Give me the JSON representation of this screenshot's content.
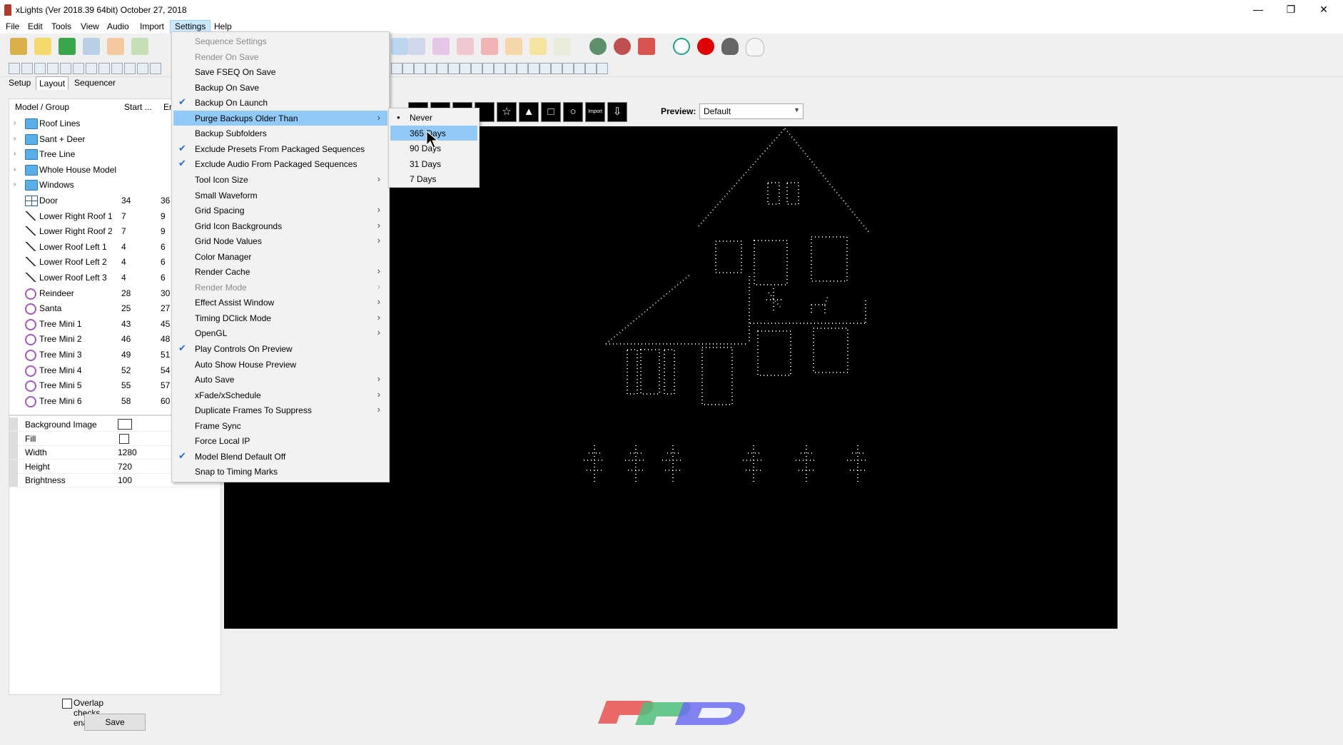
{
  "window": {
    "title": "xLights  (Ver 2018.39 64bit) October 27, 2018",
    "minimize": "—",
    "restore": "❐",
    "close": "✕"
  },
  "menubar": [
    "File",
    "Edit",
    "Tools",
    "View",
    "Audio",
    "Import",
    "Settings",
    "Help"
  ],
  "tabs": [
    "Setup",
    "Layout",
    "Sequencer"
  ],
  "model_list": {
    "headers": {
      "name": "Model / Group",
      "start": "Start ...",
      "end": "Er"
    },
    "rows": [
      {
        "name": "Roof Lines",
        "start": "",
        "end": "",
        "icon": "folder-icon",
        "expand": "›"
      },
      {
        "name": "Sant + Deer",
        "start": "",
        "end": "",
        "icon": "folder-icon",
        "expand": "›"
      },
      {
        "name": "Tree Line",
        "start": "",
        "end": "",
        "icon": "folder-icon",
        "expand": "›"
      },
      {
        "name": "Whole House Model",
        "start": "",
        "end": "",
        "icon": "folder-icon",
        "expand": "›"
      },
      {
        "name": "Windows",
        "start": "",
        "end": "",
        "icon": "folder-icon",
        "expand": "›"
      },
      {
        "name": "Door",
        "start": "34",
        "end": "36",
        "icon": "grid-icon",
        "expand": ""
      },
      {
        "name": "Lower Right Roof 1",
        "start": "7",
        "end": "9",
        "icon": "line-icon",
        "expand": ""
      },
      {
        "name": "Lower Right Roof 2",
        "start": "7",
        "end": "9",
        "icon": "line-icon",
        "expand": ""
      },
      {
        "name": "Lower Roof Left 1",
        "start": "4",
        "end": "6",
        "icon": "line-icon",
        "expand": ""
      },
      {
        "name": "Lower Roof Left 2",
        "start": "4",
        "end": "6",
        "icon": "line-icon",
        "expand": ""
      },
      {
        "name": "Lower Roof Left 3",
        "start": "4",
        "end": "6",
        "icon": "line-icon",
        "expand": ""
      },
      {
        "name": "Reindeer",
        "start": "28",
        "end": "30",
        "icon": "custom-model-icon",
        "expand": ""
      },
      {
        "name": "Santa",
        "start": "25",
        "end": "27",
        "icon": "custom-model-icon",
        "expand": ""
      },
      {
        "name": "Tree Mini 1",
        "start": "43",
        "end": "45",
        "icon": "custom-model-icon",
        "expand": ""
      },
      {
        "name": "Tree Mini 2",
        "start": "46",
        "end": "48",
        "icon": "custom-model-icon",
        "expand": ""
      },
      {
        "name": "Tree Mini 3",
        "start": "49",
        "end": "51",
        "icon": "custom-model-icon",
        "expand": ""
      },
      {
        "name": "Tree Mini 4",
        "start": "52",
        "end": "54",
        "icon": "custom-model-icon",
        "expand": ""
      },
      {
        "name": "Tree Mini 5",
        "start": "55",
        "end": "57",
        "icon": "custom-model-icon",
        "expand": ""
      },
      {
        "name": "Tree Mini 6",
        "start": "58",
        "end": "60",
        "icon": "custom-model-icon",
        "expand": ""
      }
    ]
  },
  "properties": [
    {
      "key": "Background Image",
      "value": ""
    },
    {
      "key": "Fill",
      "value": ""
    },
    {
      "key": "Width",
      "value": "1280"
    },
    {
      "key": "Height",
      "value": "720"
    },
    {
      "key": "Brightness",
      "value": "100"
    }
  ],
  "overlap_label": "Overlap checks enabled",
  "save_label": "Save",
  "preview": {
    "label": "Preview:",
    "value": "Default",
    "import_label": "Import"
  },
  "settings_menu": [
    {
      "label": "Sequence Settings",
      "disabled": true,
      "checked": false,
      "submenu": false
    },
    {
      "label": "Render On Save",
      "disabled": true,
      "checked": false,
      "submenu": false
    },
    {
      "label": "Save FSEQ On Save",
      "disabled": false,
      "checked": false,
      "submenu": false
    },
    {
      "label": "Backup On Save",
      "disabled": false,
      "checked": false,
      "submenu": false
    },
    {
      "label": "Backup On Launch",
      "disabled": false,
      "checked": true,
      "submenu": false
    },
    {
      "label": "Purge Backups Older Than",
      "disabled": false,
      "checked": false,
      "submenu": true,
      "highlighted": true
    },
    {
      "label": "Backup Subfolders",
      "disabled": false,
      "checked": false,
      "submenu": false
    },
    {
      "label": "Exclude Presets From Packaged Sequences",
      "disabled": false,
      "checked": true,
      "submenu": false
    },
    {
      "label": "Exclude Audio From Packaged Sequences",
      "disabled": false,
      "checked": true,
      "submenu": false
    },
    {
      "label": "Tool Icon Size",
      "disabled": false,
      "checked": false,
      "submenu": true
    },
    {
      "label": "Small Waveform",
      "disabled": false,
      "checked": false,
      "submenu": false
    },
    {
      "label": "Grid Spacing",
      "disabled": false,
      "checked": false,
      "submenu": true
    },
    {
      "label": "Grid Icon Backgrounds",
      "disabled": false,
      "checked": false,
      "submenu": true
    },
    {
      "label": "Grid Node Values",
      "disabled": false,
      "checked": false,
      "submenu": true
    },
    {
      "label": "Color Manager",
      "disabled": false,
      "checked": false,
      "submenu": false
    },
    {
      "label": "Render Cache",
      "disabled": false,
      "checked": false,
      "submenu": true
    },
    {
      "label": "Render Mode",
      "disabled": true,
      "checked": false,
      "submenu": true
    },
    {
      "label": "Effect Assist Window",
      "disabled": false,
      "checked": false,
      "submenu": true
    },
    {
      "label": "Timing DClick Mode",
      "disabled": false,
      "checked": false,
      "submenu": true
    },
    {
      "label": "OpenGL",
      "disabled": false,
      "checked": false,
      "submenu": true
    },
    {
      "label": "Play Controls On Preview",
      "disabled": false,
      "checked": true,
      "submenu": false
    },
    {
      "label": "Auto Show House Preview",
      "disabled": false,
      "checked": false,
      "submenu": false
    },
    {
      "label": "Auto Save",
      "disabled": false,
      "checked": false,
      "submenu": true
    },
    {
      "label": "xFade/xSchedule",
      "disabled": false,
      "checked": false,
      "submenu": true
    },
    {
      "label": "Duplicate Frames To Suppress",
      "disabled": false,
      "checked": false,
      "submenu": true
    },
    {
      "label": "Frame Sync",
      "disabled": false,
      "checked": false,
      "submenu": false
    },
    {
      "label": "Force Local IP",
      "disabled": false,
      "checked": false,
      "submenu": false
    },
    {
      "label": "Model Blend Default Off",
      "disabled": false,
      "checked": true,
      "submenu": false
    },
    {
      "label": "Snap to Timing Marks",
      "disabled": false,
      "checked": false,
      "submenu": false
    }
  ],
  "purge_submenu": [
    {
      "label": "Never",
      "selected": true,
      "highlighted": false
    },
    {
      "label": "365 Days",
      "selected": false,
      "highlighted": true
    },
    {
      "label": "90 Days",
      "selected": false,
      "highlighted": false
    },
    {
      "label": "31 Days",
      "selected": false,
      "highlighted": false
    },
    {
      "label": "7 Days",
      "selected": false,
      "highlighted": false
    }
  ],
  "colors": {
    "menu_highlight": "#91c9f7",
    "check_blue": "#1b6ed6",
    "canvas": "#000000",
    "logo_red": "#e8514f",
    "logo_green": "#4fbf7b",
    "logo_blue": "#6b6ff0"
  }
}
